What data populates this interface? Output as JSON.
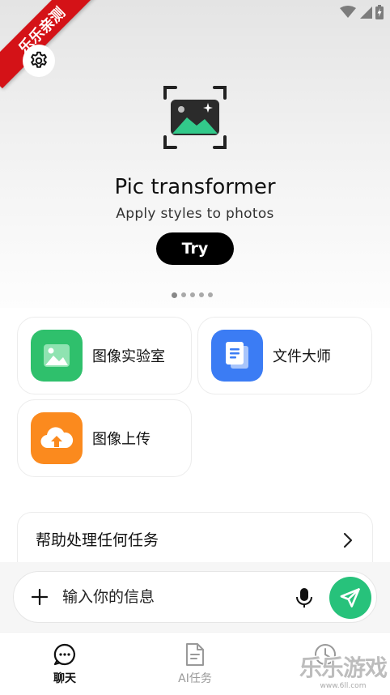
{
  "watermark": {
    "ribbon_text": "乐乐亲测",
    "logo_text": "乐乐游戏",
    "logo_url": "www.6ll.com"
  },
  "status_bar": {
    "icons": [
      "wifi-icon",
      "cellular-signal-icon",
      "battery-charging-icon"
    ]
  },
  "hero": {
    "icon": "image-transform-icon",
    "title": "Pic transformer",
    "subtitle": "Apply styles to photos",
    "cta_label": "Try",
    "pager": {
      "count": 5,
      "active_index": 0
    }
  },
  "features": [
    {
      "label": "图像实验室",
      "icon": "image-lab-icon",
      "color": "#2fc06c"
    },
    {
      "label": "文件大师",
      "icon": "document-icon",
      "color": "#3b7cf4"
    },
    {
      "label": "图像上传",
      "icon": "cloud-upload-icon",
      "color": "#fb8a1e"
    }
  ],
  "help": {
    "label": "帮助处理任何任务"
  },
  "composer": {
    "placeholder": "输入你的信息"
  },
  "nav": [
    {
      "label": "聊天",
      "icon": "chat-bubble-icon",
      "active": true
    },
    {
      "label": "AI任务",
      "icon": "ai-task-document-icon",
      "active": false
    },
    {
      "label": "",
      "icon": "history-clock-icon",
      "active": false
    }
  ],
  "colors": {
    "accent": "#27c27b",
    "ribbon": "#d41217",
    "cta": "#000000"
  }
}
